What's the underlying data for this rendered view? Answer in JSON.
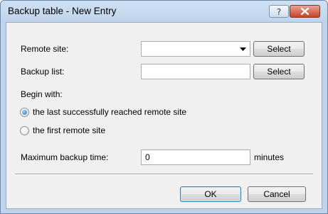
{
  "window": {
    "title": "Backup table - New Entry"
  },
  "form": {
    "remote_site": {
      "label": "Remote site:",
      "value": "",
      "button": "Select"
    },
    "backup_list": {
      "label": "Backup list:",
      "value": "",
      "button": "Select"
    },
    "begin_with": {
      "label": "Begin with:",
      "options": [
        {
          "label": "the last successfully reached remote site",
          "selected": true
        },
        {
          "label": "the first remote site",
          "selected": false
        }
      ]
    },
    "max_backup_time": {
      "label": "Maximum backup time:",
      "value": "0",
      "unit": "minutes"
    }
  },
  "buttons": {
    "ok": "OK",
    "cancel": "Cancel"
  },
  "icons": {
    "help": "question-mark-icon",
    "close": "close-x-icon"
  }
}
